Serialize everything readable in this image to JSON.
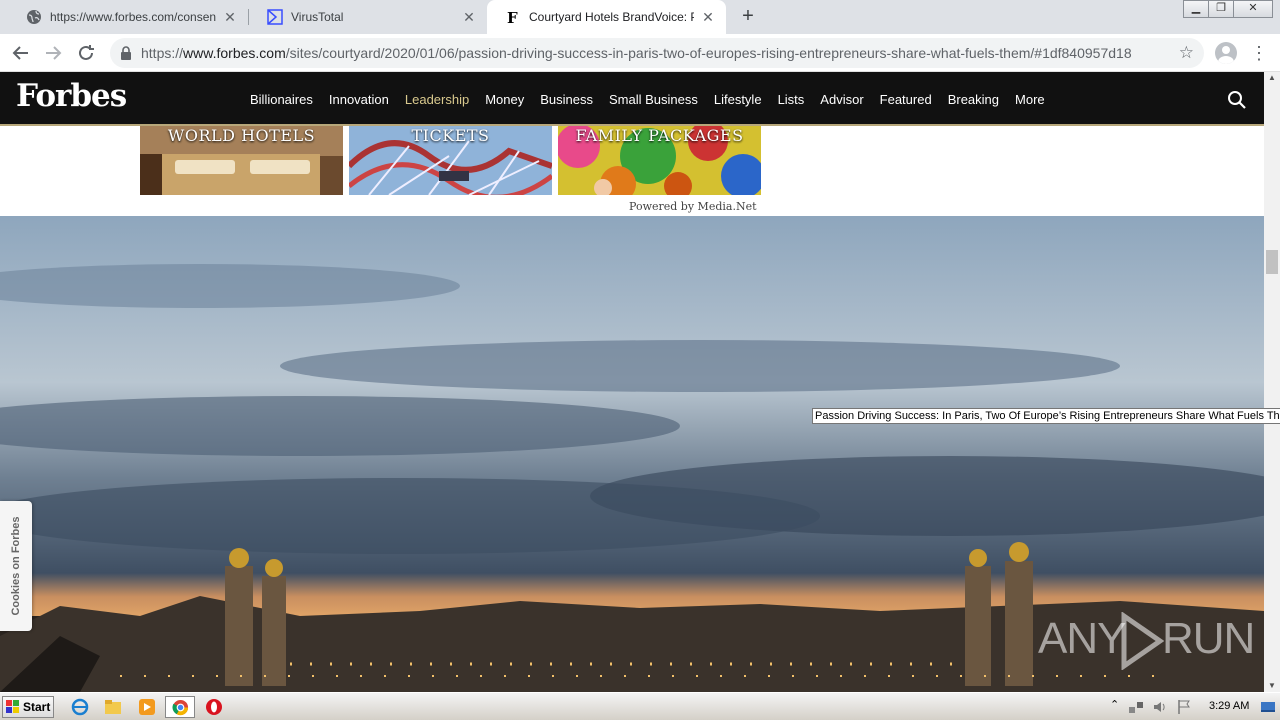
{
  "browser": {
    "tabs": [
      {
        "title": "https://www.forbes.com/consent/?t",
        "favicon": "globe-icon",
        "active": false
      },
      {
        "title": "VirusTotal",
        "favicon": "virustotal-icon",
        "active": false
      },
      {
        "title": "Courtyard Hotels BrandVoice: Passio",
        "favicon": "forbes-f-icon",
        "active": true
      }
    ],
    "new_tab": "+",
    "address": {
      "scheme": "https://",
      "host": "www.forbes.com",
      "path": "/sites/courtyard/2020/01/06/passion-driving-success-in-paris-two-of-europes-rising-entrepreneurs-share-what-fuels-them/#1df840957d18"
    }
  },
  "forbes": {
    "logo": "Forbes",
    "nav": [
      "Billionaires",
      "Innovation",
      "Leadership",
      "Money",
      "Business",
      "Small Business",
      "Lifestyle",
      "Lists",
      "Advisor",
      "Featured",
      "Breaking",
      "More"
    ],
    "active_nav": "Leadership",
    "accent_color": "#d9c98e"
  },
  "ads": {
    "items": [
      "WORLD HOTELS",
      "TICKETS",
      "FAMILY PACKAGES"
    ],
    "powered_by": "Powered by Media.Net"
  },
  "tooltip": "Passion Driving Success: In Paris, Two Of Europe’s Rising Entrepreneurs Share What Fuels Them",
  "cookies_tab": "Cookies on Forbes",
  "watermark": {
    "left": "ANY",
    "right": "RUN"
  },
  "taskbar": {
    "start": "Start",
    "clock": "3:29 AM"
  }
}
